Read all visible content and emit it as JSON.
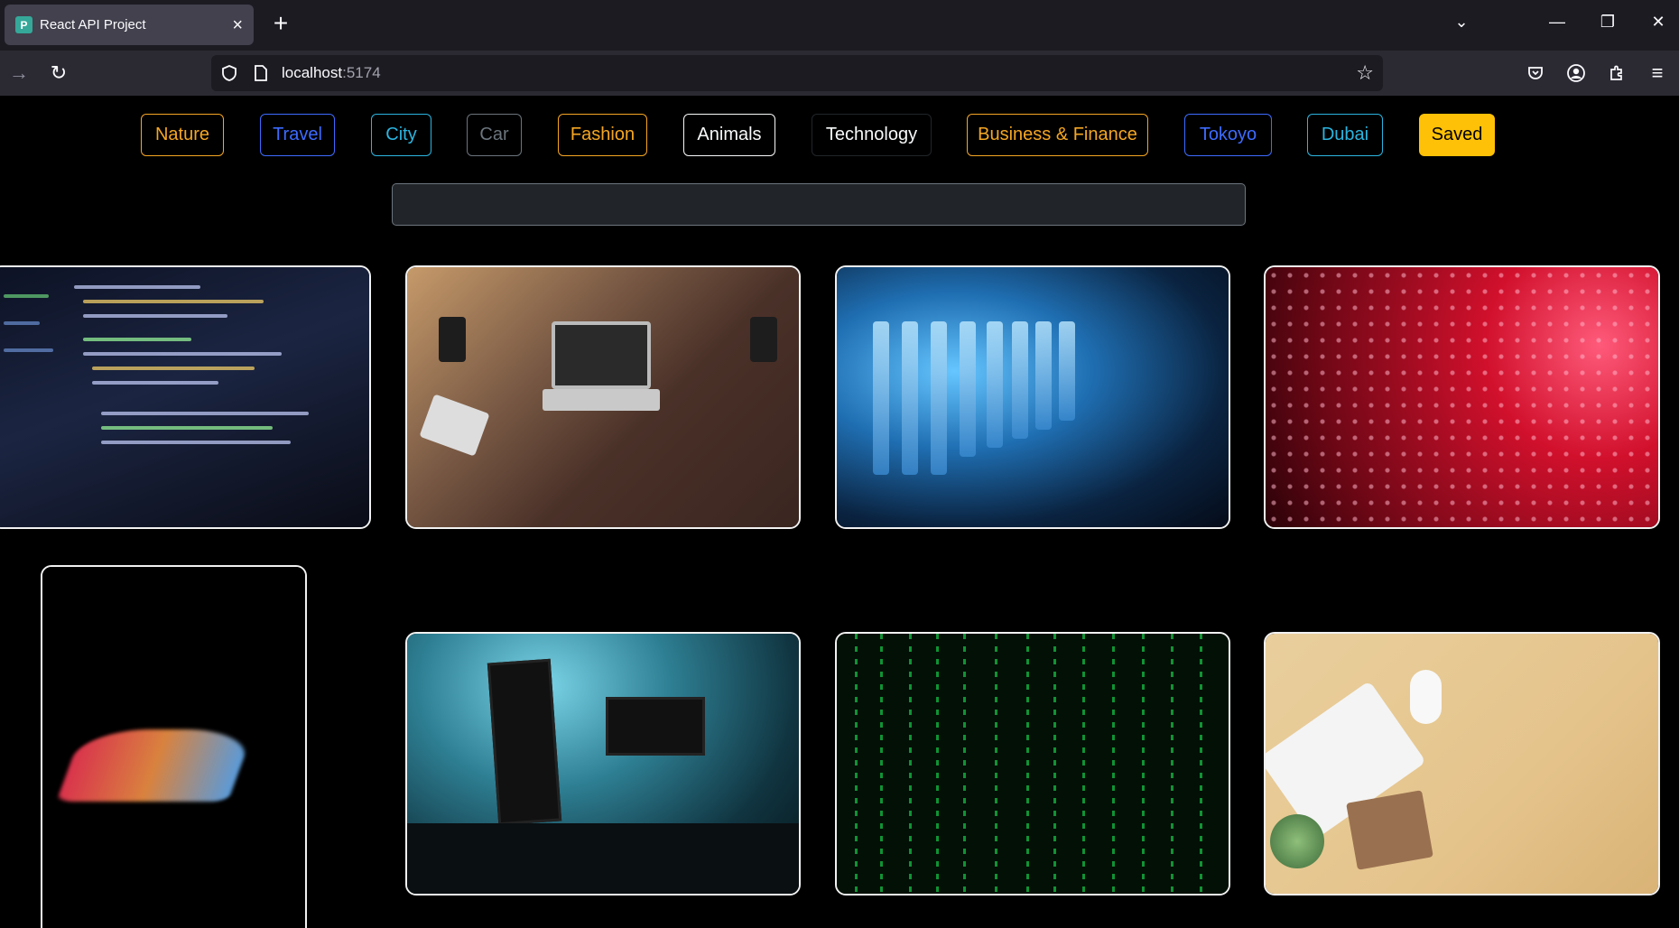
{
  "browser": {
    "tab_title": "React API Project",
    "favicon_letter": "P",
    "url_host": "localhost",
    "url_port": ":5174"
  },
  "categories": [
    {
      "label": "Nature",
      "color": "#f5a623"
    },
    {
      "label": "Travel",
      "color": "#3d6bff"
    },
    {
      "label": "City",
      "color": "#2bb5e0"
    },
    {
      "label": "Car",
      "color": "#6c757d"
    },
    {
      "label": "Fashion",
      "color": "#f5a623"
    },
    {
      "label": "Animals",
      "color": "#f8f9fa"
    },
    {
      "label": "Technology",
      "color": "#212529"
    },
    {
      "label": "Business & Finance",
      "color": "#f5a623"
    },
    {
      "label": "Tokoyo",
      "color": "#3d6bff"
    },
    {
      "label": "Dubai",
      "color": "#2bb5e0"
    },
    {
      "label": "Saved",
      "color": "#ffc107"
    }
  ],
  "search": {
    "value": "",
    "placeholder": ""
  },
  "gallery": [
    {
      "subject": "code-on-laptop"
    },
    {
      "subject": "desk-with-laptop-and-gadgets"
    },
    {
      "subject": "server-rack"
    },
    {
      "subject": "red-led-wall"
    },
    {
      "subject": "glowing-laptop-dark"
    },
    {
      "subject": "desk-setup-monitors"
    },
    {
      "subject": "matrix-green-code"
    },
    {
      "subject": "keyboard-mouse-beige-desk"
    }
  ]
}
